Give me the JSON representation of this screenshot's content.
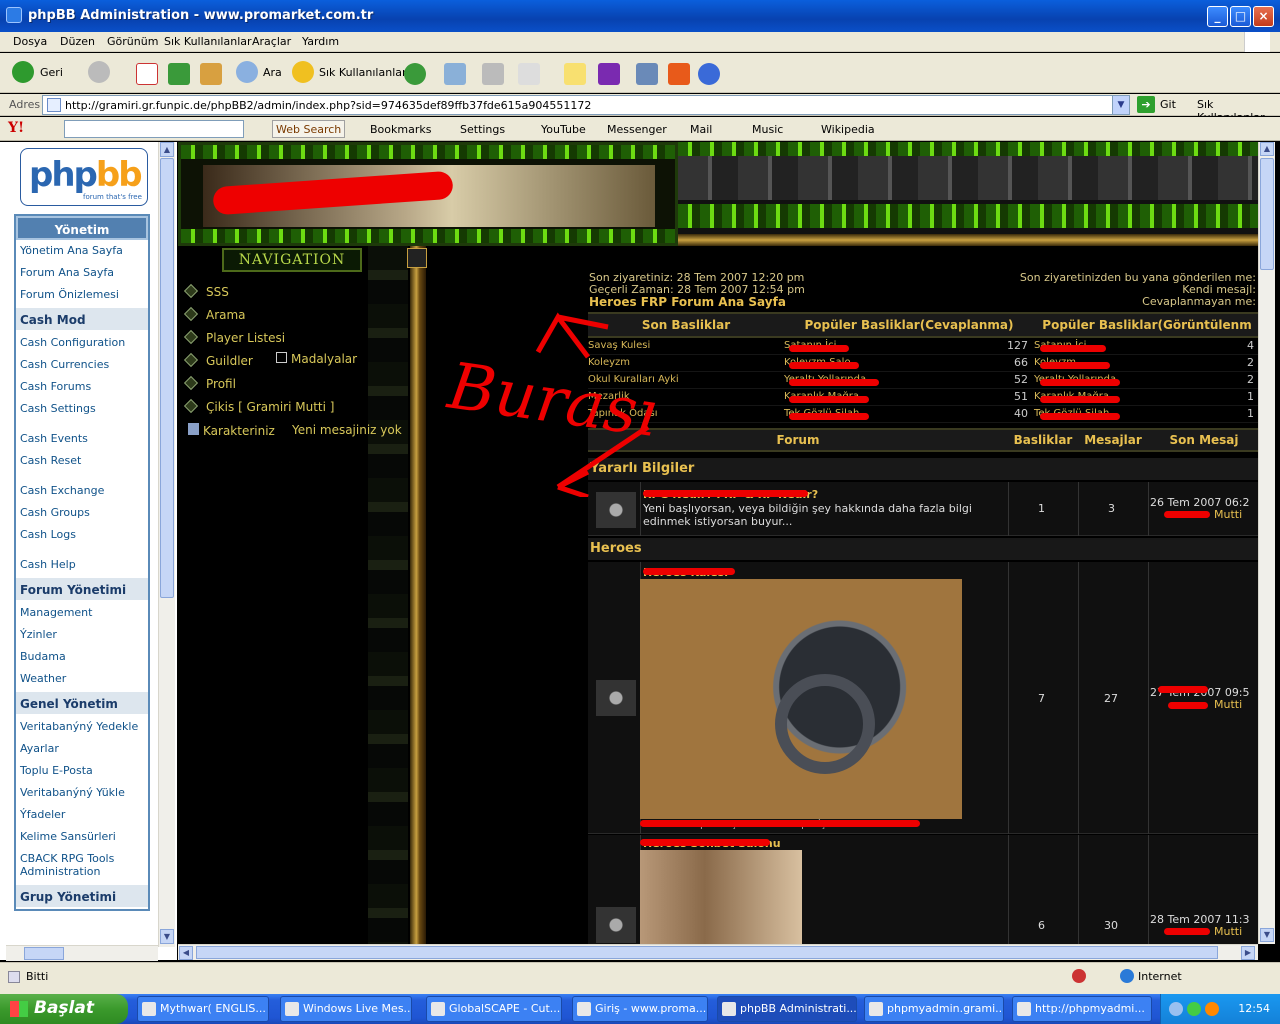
{
  "window": {
    "title": "phpBB Administration - www.promarket.com.tr"
  },
  "menubar": [
    "Dosya",
    "Düzen",
    "Görünüm",
    "Sık Kullanılanlar",
    "Araçlar",
    "Yardım"
  ],
  "toolbar": {
    "back_label": "Geri",
    "search_label": "Ara",
    "favorites_label": "Sık Kullanılanlar"
  },
  "address": {
    "label": "Adres",
    "url": "http://gramiri.gr.funpic.de/phpBB2/admin/index.php?sid=974635def89ffb37fde615a904551172",
    "go_label": "Git",
    "links_label": "Sık Kullanılanlar"
  },
  "yahoo": {
    "logo": "Y!",
    "web_search": "Web Search",
    "items": [
      "Bookmarks",
      "Settings",
      "YouTube",
      "Messenger",
      "Mail",
      "Music",
      "Wikipedia"
    ]
  },
  "admin_menu": {
    "logo_text": "phpbb",
    "logo_tag": "forum that's free",
    "header": "Yönetim",
    "top_items": [
      "Yönetim Ana Sayfa",
      "Forum Ana Sayfa",
      "Forum Önizlemesi"
    ],
    "cash_title": "Cash Mod",
    "cash_group1": [
      "Cash Configuration",
      "Cash Currencies",
      "Cash Forums",
      "Cash Settings"
    ],
    "cash_group2": [
      "Cash Events",
      "Cash Reset"
    ],
    "cash_group3": [
      "Cash Exchange",
      "Cash Groups",
      "Cash Logs"
    ],
    "cash_group4": [
      "Cash Help"
    ],
    "forum_title": "Forum Yönetimi",
    "forum_items": [
      "Management",
      "Ýzinler",
      "Budama",
      "Weather"
    ],
    "general_title": "Genel Yönetim",
    "general_items": [
      "Veritabanýný Yedekle",
      "Ayarlar",
      "Toplu E-Posta",
      "Veritabanýný Yükle",
      "Ýfadeler",
      "Kelime Sansürleri",
      "CBACK RPG Tools Administration"
    ],
    "group_title": "Grup Yönetimi"
  },
  "nav": {
    "title": "NAVIGATION",
    "items": [
      "SSS",
      "Arama",
      "Player Listesi",
      "Guildler",
      "Profil",
      "Çikis [ Gramiri Mutti ]"
    ],
    "medals": "Madalyalar",
    "character": "Karakteriniz",
    "no_messages": "Yeni mesajiniz yok"
  },
  "info": {
    "last_visit": "Son ziyaretiniz: 28 Tem 2007 12:20 pm",
    "current_time": "Geçerli Zaman: 28 Tem 2007 12:54 pm",
    "forum_home": "Heroes FRP Forum Ana Sayfa",
    "since_last": "Son ziyaretinizden bu yana gönderilen me:",
    "own_messages": "Kendi mesajl:",
    "unanswered": "Cevaplanmayan me:"
  },
  "topics_table": {
    "headers": [
      "Son Basliklar",
      "Popüler Basliklar(Cevaplanma)",
      "Popüler Basliklar(Görüntülenm"
    ],
    "rows": [
      {
        "recent": "Savaş Kulesi",
        "popular": "Satanın İçi",
        "count": "127",
        "popular2": "Satanın İçi",
        "views": "4"
      },
      {
        "recent": "Koleyzm",
        "popular": "Koleyzm Salo",
        "count": "66",
        "popular2": "Koleyzm",
        "views": "2"
      },
      {
        "recent": "Okul Kuralları Ayki",
        "popular": "Yeraltı Yollarında",
        "count": "52",
        "popular2": "Yeraltı Yollarında",
        "views": "2"
      },
      {
        "recent": "Mezarlik",
        "popular": "Karanlık Mağra",
        "count": "51",
        "popular2": "Karanlık Mağra",
        "views": "1"
      },
      {
        "recent": "Tapınak Odası",
        "popular": "Tek Gözlü Silah",
        "count": "40",
        "popular2": "Tek Gözlü Silah",
        "views": "1"
      }
    ]
  },
  "forum_table": {
    "headers": [
      "Forum",
      "Basliklar",
      "Mesajlar",
      "Son Mesaj"
    ],
    "categories": [
      {
        "name": "Yararlı Bilgiler",
        "forums": [
          {
            "title": "RPG Nedir? FRP & RP Nedir?",
            "desc": "Yeni başlıyorsan, veya bildiğin şey hakkında daha fazla bilgi edinmek istiyorsan buyur...",
            "topics": "1",
            "posts": "3",
            "last_date": "26 Tem 2007 06:2",
            "last_user": "Mutti"
          }
        ]
      },
      {
        "name": "Heroes",
        "forums": [
          {
            "title": "Heroes Kalesi",
            "caption": "Heroesun Kapıları Açılana Kadar Sepin İçeri Gel",
            "topics": "7",
            "posts": "27",
            "last_date": "27 Tem 2007 09:5",
            "last_user": "Mutti"
          },
          {
            "title": "Heroes Sohbet Salonu",
            "topics": "6",
            "posts": "30",
            "last_date": "28 Tem 2007 11:3",
            "last_user": "Mutti"
          }
        ]
      }
    ]
  },
  "annotation": {
    "handwritten": "Burası"
  },
  "statusbar": {
    "status": "Bitti",
    "zone": "Internet"
  },
  "taskbar": {
    "start": "Başlat",
    "tasks": [
      "Mythwar( ENGLIS...",
      "Windows Live Mes...",
      "GlobalSCAPE - Cut...",
      "Giriş - www.proma...",
      "phpBB Administrati...",
      "phpmyadmin.grami...",
      "http://phpmyadmi..."
    ],
    "clock": "12:54"
  }
}
